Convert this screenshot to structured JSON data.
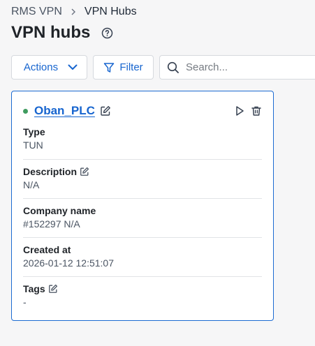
{
  "breadcrumb": {
    "root": "RMS VPN",
    "current": "VPN Hubs"
  },
  "page": {
    "title": "VPN hubs"
  },
  "toolbar": {
    "actions_label": "Actions",
    "filter_label": "Filter",
    "search_placeholder": "Search..."
  },
  "hub": {
    "name": "Oban_PLC",
    "status_color": "#3f9b5f",
    "type_label": "Type",
    "type_value": "TUN",
    "description_label": "Description",
    "description_value": "N/A",
    "company_label": "Company name",
    "company_value": "#152297 N/A",
    "created_label": "Created at",
    "created_value": "2026-01-12 12:51:07",
    "tags_label": "Tags",
    "tags_value": "-"
  },
  "colors": {
    "accent": "#1765cf",
    "border": "#1c6bd2"
  },
  "icons": [
    "chevron-right-icon",
    "help-icon",
    "chevron-down-icon",
    "filter-icon",
    "search-icon",
    "edit-icon",
    "play-icon",
    "trash-icon"
  ]
}
